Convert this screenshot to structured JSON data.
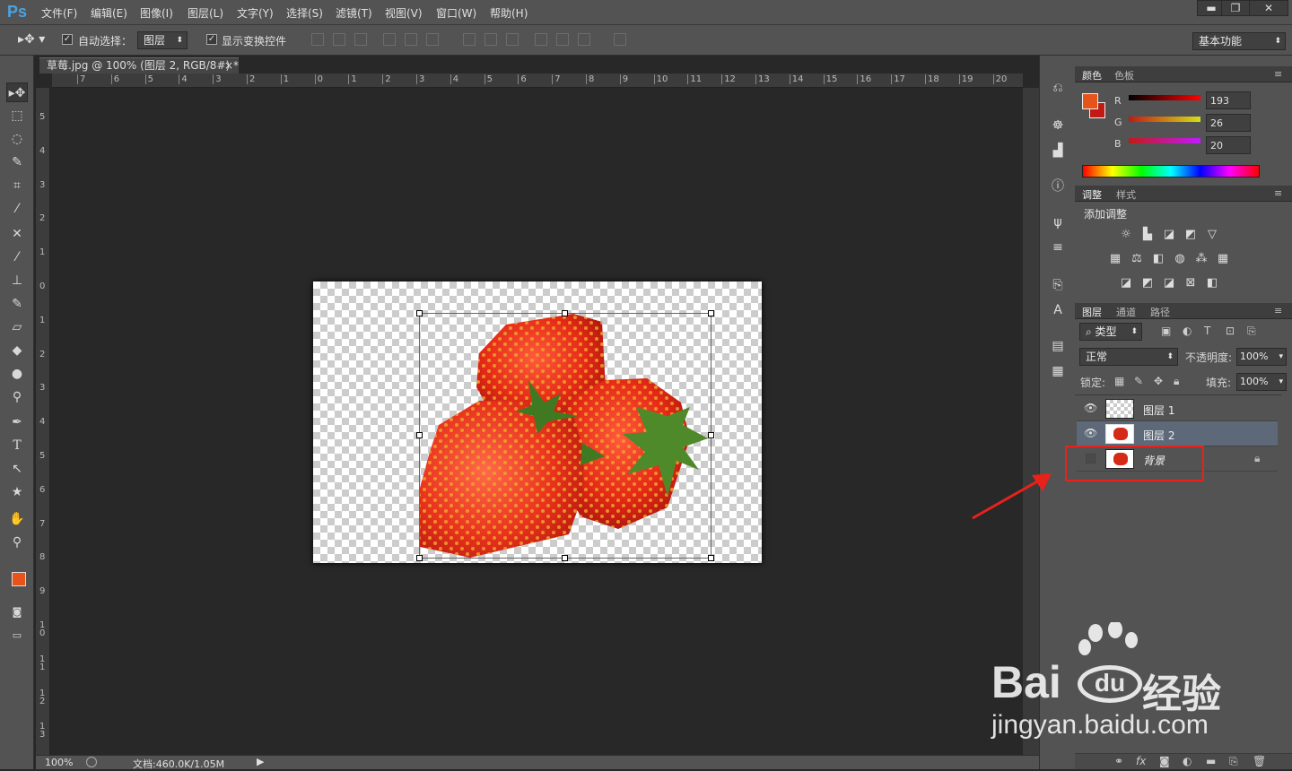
{
  "app": {
    "logo": "Ps"
  },
  "menu": [
    "文件(F)",
    "编辑(E)",
    "图像(I)",
    "图层(L)",
    "文字(Y)",
    "选择(S)",
    "滤镜(T)",
    "视图(V)",
    "窗口(W)",
    "帮助(H)"
  ],
  "window_controls": {
    "minimize": "▬",
    "restore": "❐",
    "close": "✕"
  },
  "options": {
    "auto_select_label": "自动选择：",
    "auto_select_value": "图层",
    "show_transform_label": "显示变换控件",
    "workspace": "基本功能"
  },
  "document": {
    "tab_title": "草莓.jpg @ 100% (图层 2, RGB/8#) *",
    "close": "×",
    "zoom": "100%",
    "doc_size": "文档:460.0K/1.05M"
  },
  "rulers": {
    "h_ticks": [
      "7",
      "6",
      "5",
      "4",
      "3",
      "2",
      "1",
      "0",
      "1",
      "2",
      "3",
      "4",
      "5",
      "6",
      "7",
      "8",
      "9",
      "10",
      "11",
      "12",
      "13",
      "14",
      "15",
      "16",
      "17",
      "18",
      "19",
      "20"
    ],
    "v_ticks": [
      "5",
      "4",
      "3",
      "2",
      "1",
      "0",
      "1",
      "2",
      "3",
      "4",
      "5",
      "6",
      "7",
      "8",
      "9",
      "1 0",
      "1 1",
      "1 2",
      "1 3"
    ]
  },
  "color_panel": {
    "tabs": [
      "颜色",
      "色板"
    ],
    "channels": [
      {
        "label": "R",
        "value": "193"
      },
      {
        "label": "G",
        "value": "26"
      },
      {
        "label": "B",
        "value": "20"
      }
    ],
    "foreground": "#e8531a",
    "background": "#c11a14"
  },
  "adjust_panel": {
    "tabs": [
      "调整",
      "样式"
    ],
    "title": "添加调整"
  },
  "layers_panel": {
    "tabs": [
      "图层",
      "通道",
      "路径"
    ],
    "filter_type": "类型",
    "blend_mode": "正常",
    "opacity_label": "不透明度:",
    "opacity_value": "100%",
    "lock_label": "锁定:",
    "fill_label": "填充:",
    "fill_value": "100%",
    "layers": [
      {
        "name": "图层 1",
        "visible": true
      },
      {
        "name": "图层 2",
        "visible": true,
        "selected": true
      },
      {
        "name": "背景",
        "visible": false,
        "locked": true
      }
    ]
  },
  "watermark": {
    "brand": "Bai",
    "brand2": "经验",
    "url": "jingyan.baidu.com"
  }
}
